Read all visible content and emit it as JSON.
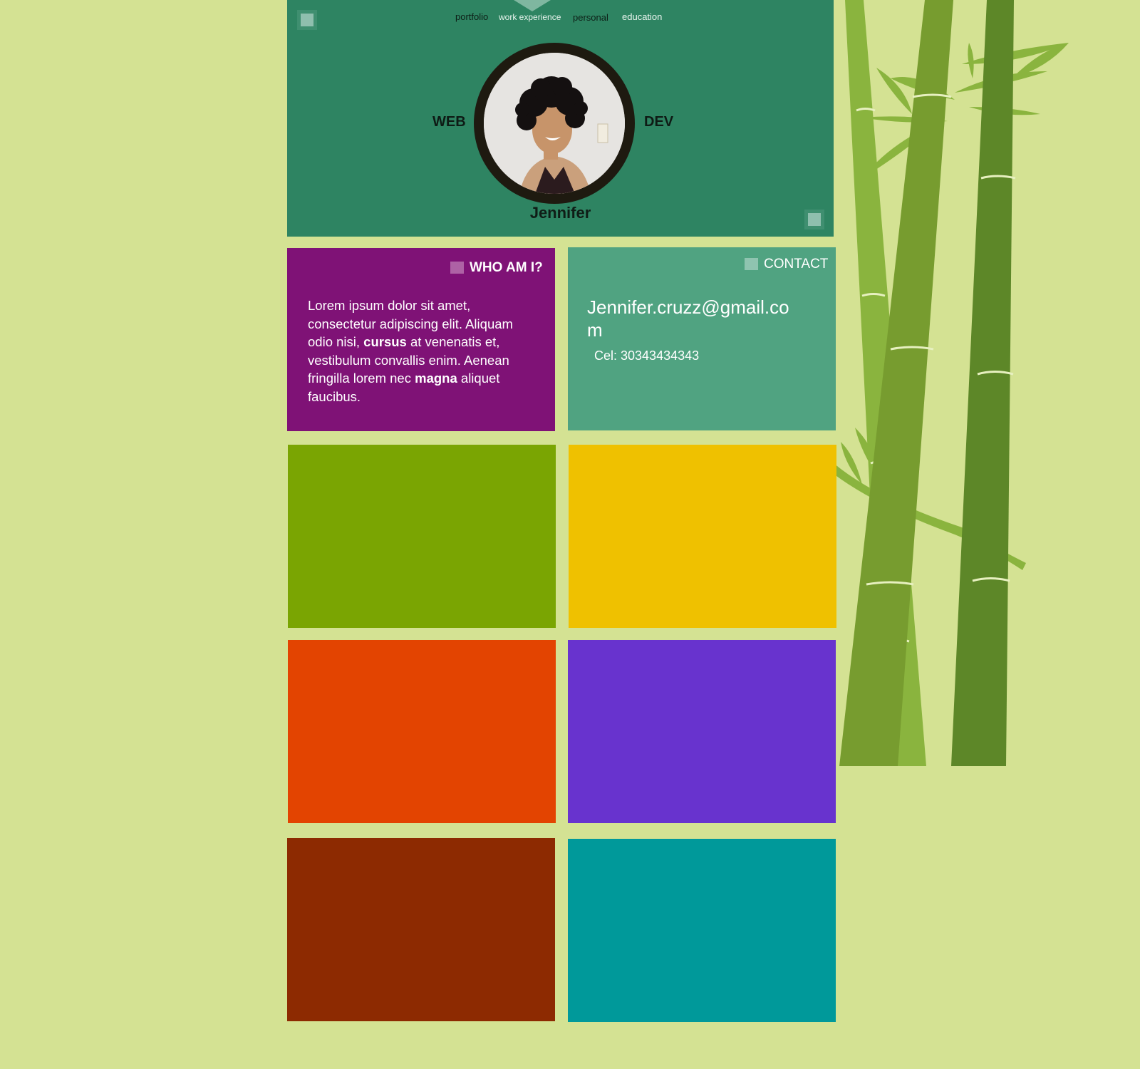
{
  "nav": {
    "items": [
      {
        "label": "portfolio"
      },
      {
        "label": "work experience"
      },
      {
        "label": "personal"
      },
      {
        "label": "education"
      }
    ]
  },
  "hero": {
    "role_left": "WEB",
    "role_right": "DEV",
    "name": "Jennifer"
  },
  "about": {
    "title": "WHO AM I?",
    "text_1": "Lorem ipsum dolor sit amet, consectetur adipiscing elit. Aliquam odio nisi, ",
    "bold_1": "cursus",
    "text_2": " at venenatis et, vestibulum convallis enim. Aenean fringilla lorem nec ",
    "bold_2": "magna",
    "text_3": " aliquet faucibus."
  },
  "contact": {
    "title": "CONTACT",
    "email": "Jennifer.cruzz@gmail.com",
    "phone": "Cel: 30343434343"
  },
  "colors": {
    "background": "#d4e293",
    "header": "#2e8462",
    "about": "#7f1276",
    "contact": "#50a381",
    "tile_green": "#7aa502",
    "tile_yellow": "#efc100",
    "tile_orange": "#e34401",
    "tile_purple": "#6833ce",
    "tile_brown": "#8d2a01",
    "tile_teal": "#00999a"
  }
}
